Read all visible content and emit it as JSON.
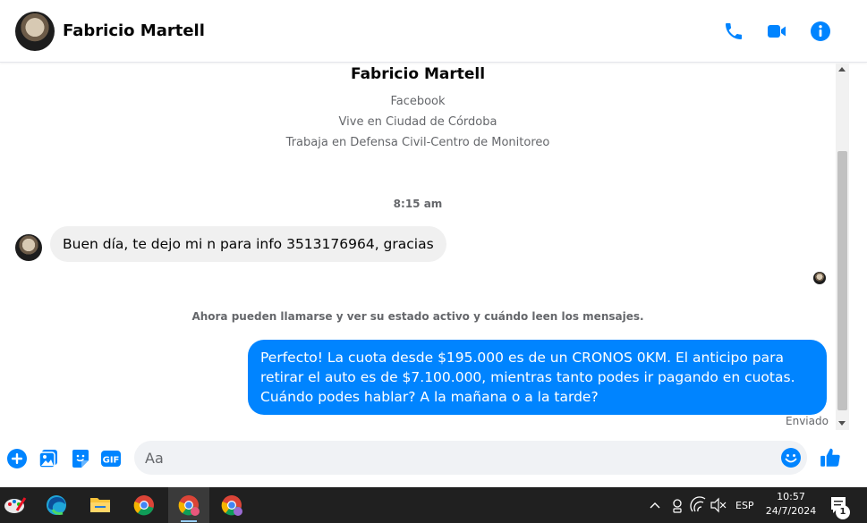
{
  "header": {
    "contact_name": "Fabricio Martell",
    "actions": [
      {
        "icon": "phone-icon"
      },
      {
        "icon": "video-camera-icon"
      },
      {
        "icon": "info-icon"
      }
    ],
    "accent_color": "#0084ff"
  },
  "profile": {
    "name": "Fabricio Martell",
    "lines": [
      "Facebook",
      "Vive en Ciudad de Córdoba",
      "Trabaja en Defensa Civil-Centro de Monitoreo"
    ]
  },
  "conversation": {
    "timestamp": "8:15 am",
    "incoming_message": "Buen día, te dejo mi n para info 3513176964, gracias",
    "system_note": "Ahora pueden llamarse y ver su estado activo y cuándo leen los mensajes.",
    "outgoing_message": "Perfecto! La cuota desde $195.000 es de un CRONOS 0KM. El anticipo para retirar el auto es de $7.100.000, mientras tanto podes ir pagando en cuotas. Cuándo podes hablar? A la mañana o a la tarde?",
    "status": "Enviado"
  },
  "composer": {
    "placeholder": "Aa",
    "gif_label": "GIF",
    "icons": [
      "plus-circle-icon",
      "gallery-icon",
      "sticker-icon",
      "gif-icon",
      "emoji-icon",
      "thumbs-up-icon"
    ]
  },
  "taskbar": {
    "apps": [
      "paint-app-icon",
      "edge-icon",
      "file-explorer-icon",
      "chrome-icon",
      "chrome-profile-c-icon",
      "chrome-profile-2-icon"
    ],
    "language": "ESP",
    "time": "10:57",
    "date": "24/7/2024",
    "notification_count": "1"
  }
}
